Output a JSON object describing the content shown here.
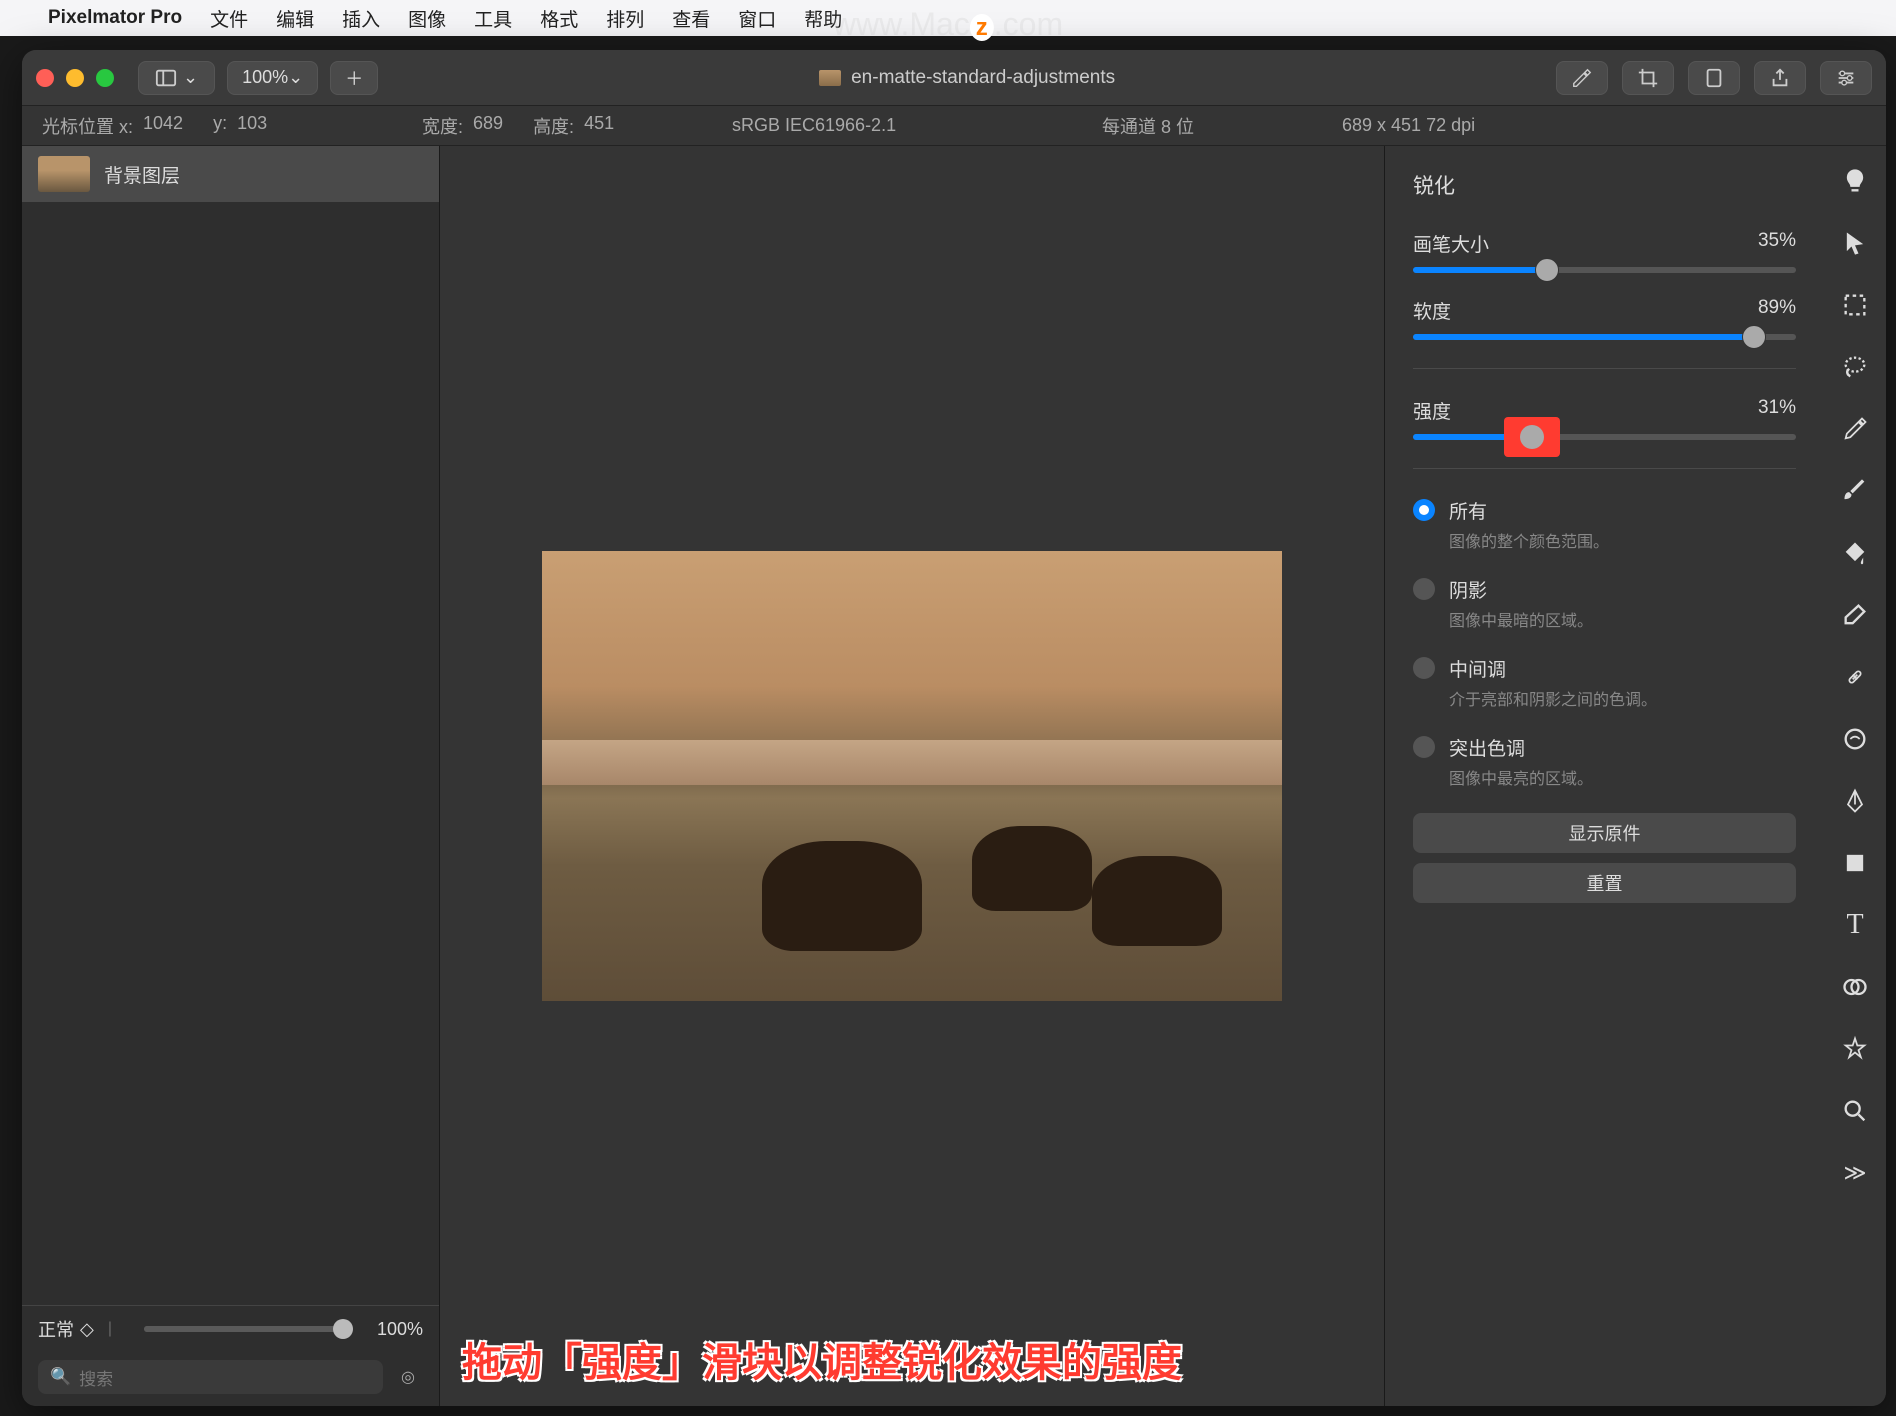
{
  "menubar": {
    "app_name": "Pixelmator Pro",
    "items": [
      "文件",
      "编辑",
      "插入",
      "图像",
      "工具",
      "格式",
      "排列",
      "查看",
      "窗口",
      "帮助"
    ]
  },
  "titlebar": {
    "zoom": "100%",
    "doc_title": "en-matte-standard-adjustments"
  },
  "infobar": {
    "cursor_label": "光标位置 x:",
    "cursor_x": "1042",
    "cursor_y_label": "y:",
    "cursor_y": "103",
    "width_label": "宽度:",
    "width": "689",
    "height_label": "高度:",
    "height": "451",
    "colorspace": "sRGB IEC61966-2.1",
    "channel": "每通道 8 位",
    "dimensions": "689 x 451 72 dpi"
  },
  "layers": {
    "items": [
      {
        "name": "背景图层"
      }
    ],
    "blend_mode": "正常",
    "opacity": "100%",
    "search_placeholder": "搜索"
  },
  "rightpanel": {
    "title": "锐化",
    "sliders": [
      {
        "label": "画笔大小",
        "value": "35%",
        "pct": 35
      },
      {
        "label": "软度",
        "value": "89%",
        "pct": 89
      },
      {
        "label": "强度",
        "value": "31%",
        "pct": 31
      }
    ],
    "radios": [
      {
        "title": "所有",
        "desc": "图像的整个颜色范围。",
        "selected": true
      },
      {
        "title": "阴影",
        "desc": "图像中最暗的区域。"
      },
      {
        "title": "中间调",
        "desc": "介于亮部和阴影之间的色调。"
      },
      {
        "title": "突出色调",
        "desc": "图像中最亮的区域。"
      }
    ],
    "show_original": "显示原件",
    "reset": "重置"
  },
  "tools": [
    "paint-icon",
    "arrow-icon",
    "marquee-icon",
    "lasso-icon",
    "eyedropper-icon",
    "brush-icon",
    "bucket-icon",
    "eraser-icon",
    "heal-icon",
    "warp-icon",
    "pen-icon",
    "rect-icon",
    "text-icon",
    "adjust-icon",
    "effects-icon",
    "magnifier-icon",
    "more-icon"
  ],
  "annotation": "拖动「强度」滑块以调整锐化效果的强度",
  "watermark": "www.Macz.com"
}
